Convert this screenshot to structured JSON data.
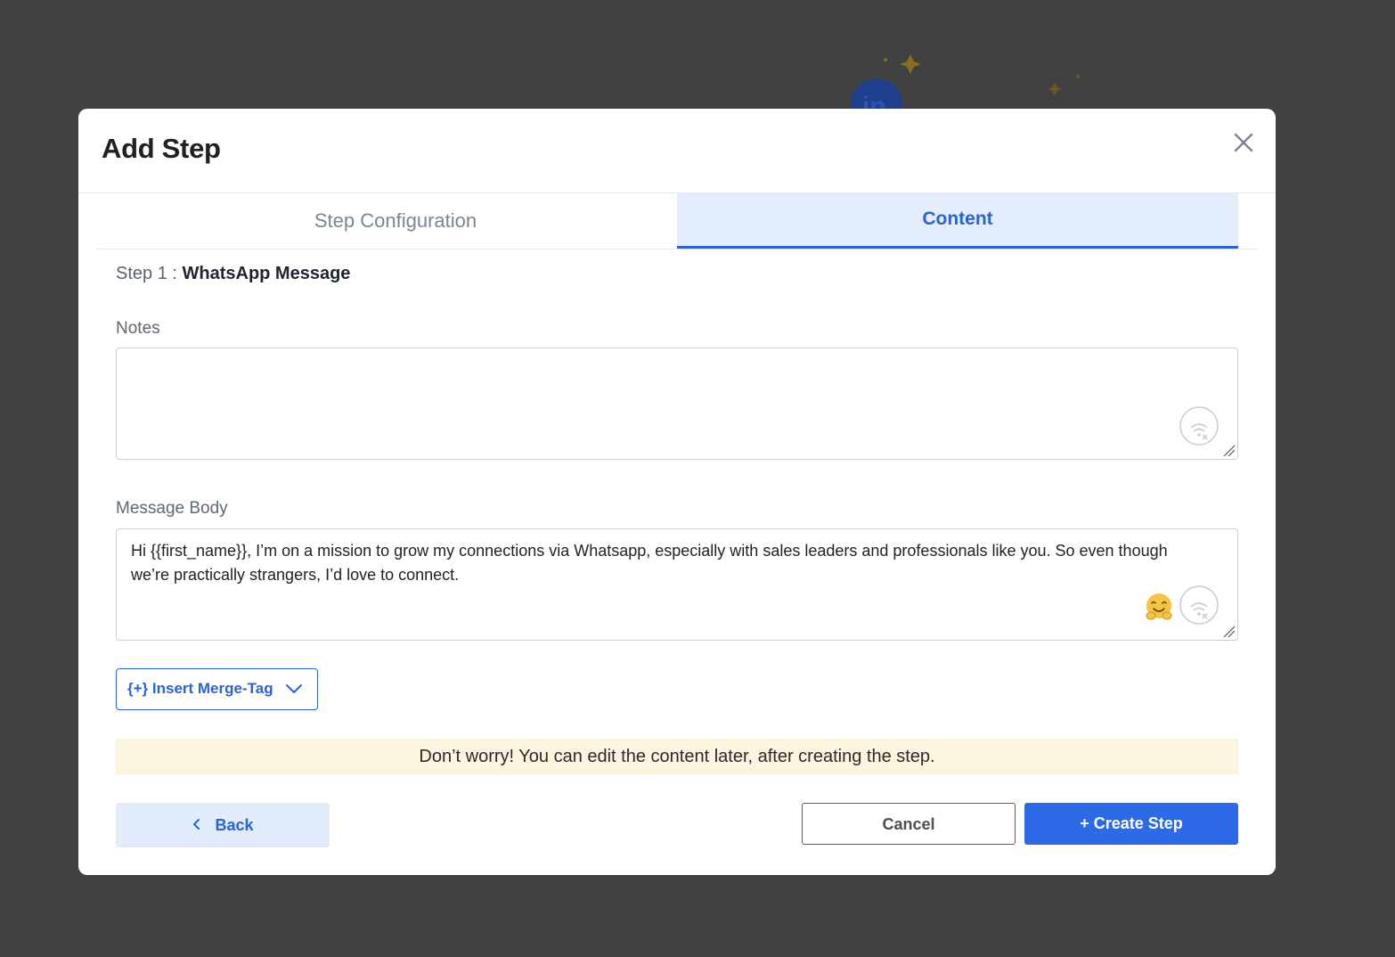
{
  "modal": {
    "title": "Add Step",
    "close_icon": "close-icon"
  },
  "tabs": [
    {
      "label": "Step Configuration",
      "active": false
    },
    {
      "label": "Content",
      "active": true
    }
  ],
  "step": {
    "prefix": "Step 1 : ",
    "type": "WhatsApp Message"
  },
  "notes": {
    "label": "Notes",
    "value": "",
    "icon": "voice-input-icon"
  },
  "message_body": {
    "label": "Message Body",
    "value": "Hi {{first_name}}, I’m on a mission to grow my connections via Whatsapp, especially with sales leaders and professionals like you. So even though we’re practically strangers, I’d love to connect.",
    "icons": [
      "emoji-picker-icon",
      "voice-input-icon"
    ]
  },
  "merge_tag": {
    "label": "{+} Insert Merge-Tag",
    "icon": "chevron-down-icon"
  },
  "info_banner": "Don’t worry! You can edit the content later, after creating the step.",
  "footer": {
    "back_label": "Back",
    "cancel_label": "Cancel",
    "create_label": "+ Create Step"
  },
  "colors": {
    "accent": "#2d6ae8",
    "tab_active_bg": "#e4edfb",
    "banner_bg": "#fbf5df",
    "overlay": "#414141"
  }
}
